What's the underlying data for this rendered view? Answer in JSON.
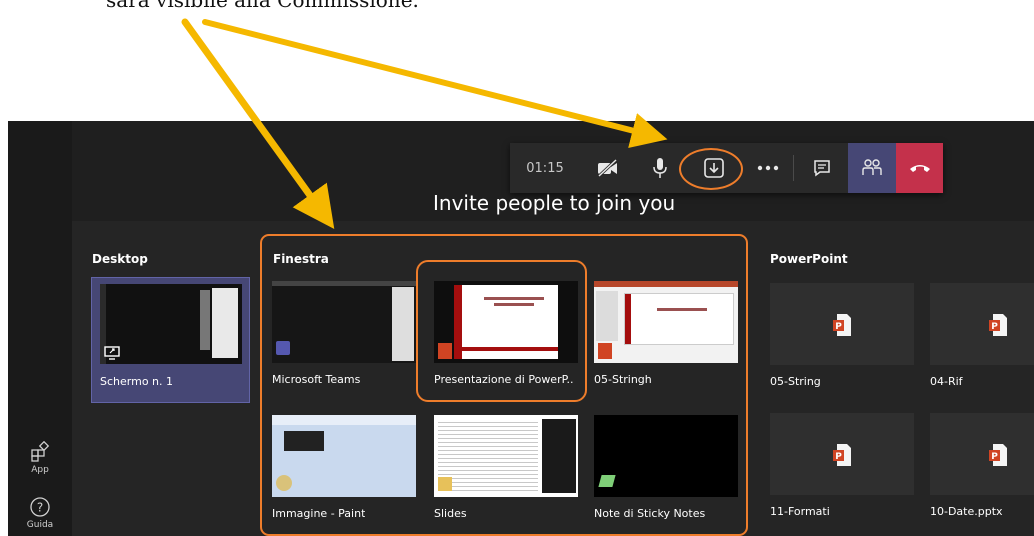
{
  "caption_top": "sarà visibile alla Commissione.",
  "left_rail": {
    "app_label": "App",
    "help_label": "Guida"
  },
  "toolbar": {
    "timer": "01:15"
  },
  "invite_text": "Invite people to join you",
  "sections": {
    "desktop": "Desktop",
    "window": "Finestra",
    "powerpoint": "PowerPoint"
  },
  "desktop_items": [
    {
      "label": "Schermo n. 1"
    }
  ],
  "window_items": [
    {
      "label": "Microsoft Teams"
    },
    {
      "label": "Presentazione di PowerP..."
    },
    {
      "label": "05-Stringh"
    },
    {
      "label": "Immagine - Paint"
    },
    {
      "label": "Slides"
    },
    {
      "label": "Note di Sticky Notes"
    }
  ],
  "ppt_items": [
    {
      "label": "05-String"
    },
    {
      "label": "04-Rif"
    },
    {
      "label": "11-Formati"
    },
    {
      "label": "10-Date.pptx"
    }
  ],
  "colors": {
    "accent_orange": "#ee7d2b",
    "arrow_yellow": "#f5b800",
    "hangup_red": "#c4314b",
    "selected_purple": "#464775"
  }
}
